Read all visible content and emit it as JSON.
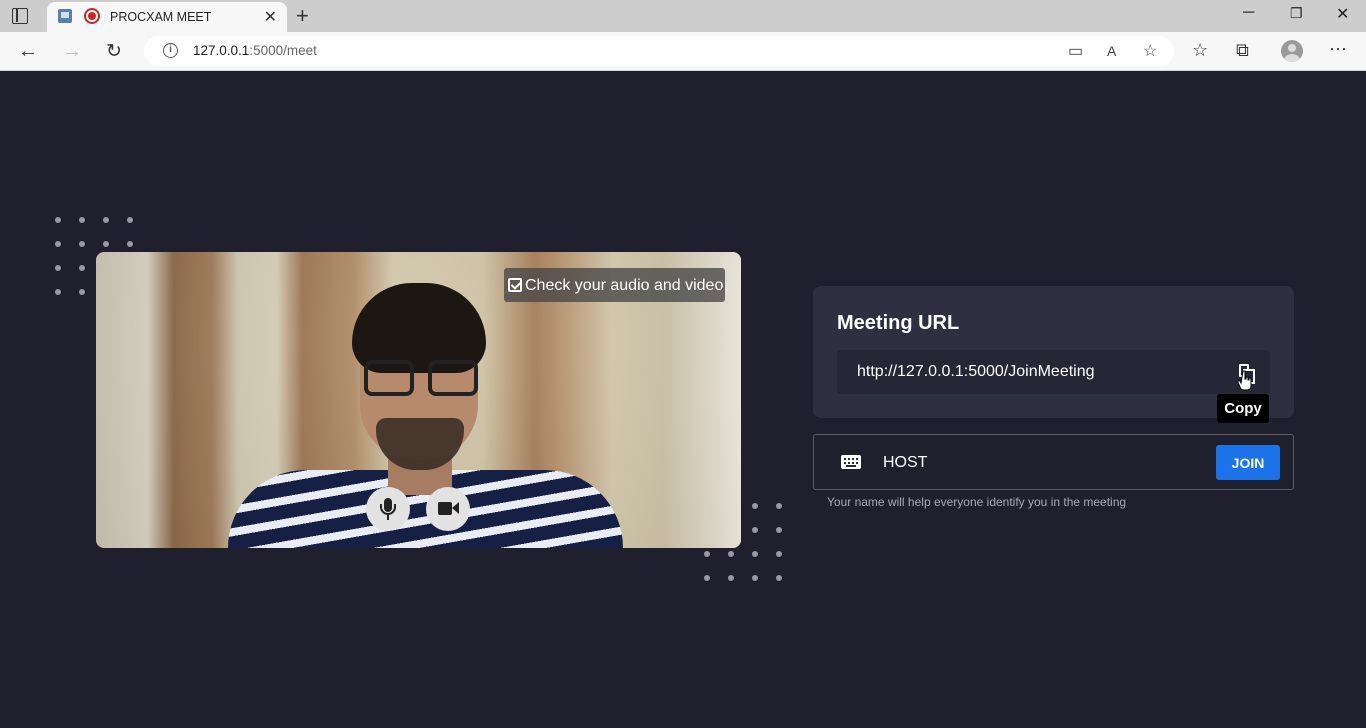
{
  "browser": {
    "tab_title": "PROCXAM MEET",
    "url_host": "127.0.0.1",
    "url_rest": ":5000/meet"
  },
  "preview": {
    "check_label": "Check your audio and video"
  },
  "meeting": {
    "heading": "Meeting URL",
    "url_value": "http://127.0.0.1:5000/JoinMeeting",
    "copy_tooltip": "Copy"
  },
  "join": {
    "name_value": "HOST",
    "button_label": "JOIN",
    "helper_text": "Your name will help everyone identify you in the meeting"
  },
  "colors": {
    "page_bg": "#1f1f2e",
    "card_bg": "#2f2f42",
    "accent": "#1a73e8"
  }
}
